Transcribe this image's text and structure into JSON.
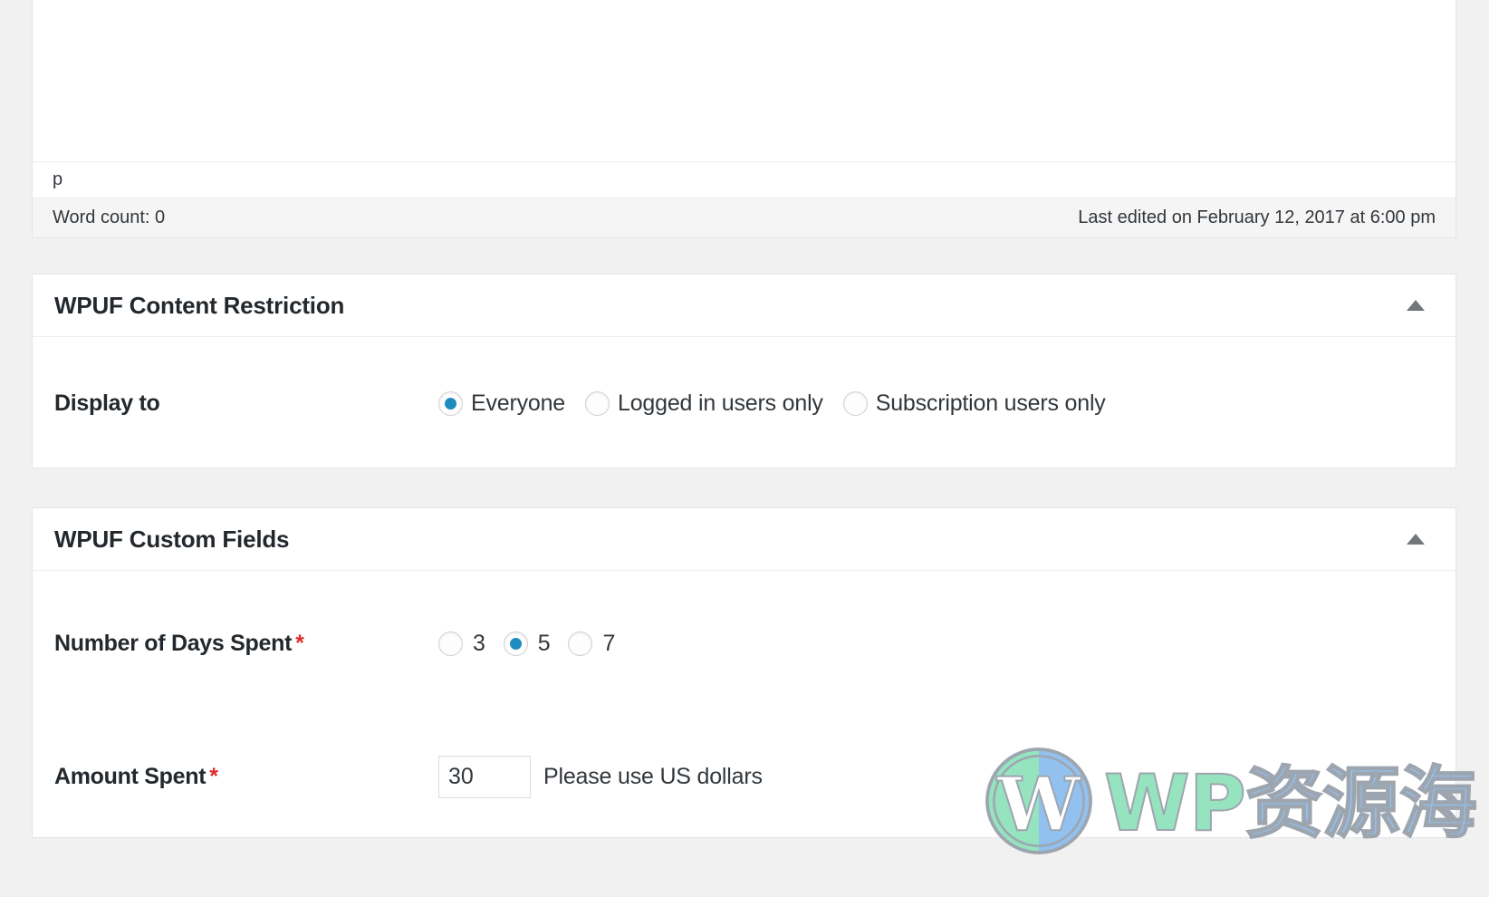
{
  "editor": {
    "path_label": "p",
    "word_count": "Word count: 0",
    "last_edited": "Last edited on February 12, 2017 at 6:00 pm"
  },
  "panels": [
    {
      "id": "content-restriction",
      "title": "WPUF Content Restriction",
      "toggle_icon": "chevron-up-icon",
      "rows": [
        {
          "label": "Display to",
          "required": false,
          "type": "radio",
          "options": [
            {
              "label": "Everyone",
              "checked": true
            },
            {
              "label": "Logged in users only",
              "checked": false
            },
            {
              "label": "Subscription users only",
              "checked": false
            }
          ]
        }
      ]
    },
    {
      "id": "custom-fields",
      "title": "WPUF Custom Fields",
      "toggle_icon": "chevron-up-icon",
      "rows": [
        {
          "label": "Number of Days Spent",
          "required": true,
          "required_mark": "*",
          "type": "radio",
          "options": [
            {
              "label": "3",
              "checked": false
            },
            {
              "label": "5",
              "checked": true
            },
            {
              "label": "7",
              "checked": false
            }
          ]
        },
        {
          "label": "Amount Spent",
          "required": true,
          "required_mark": "*",
          "type": "text",
          "value": "30",
          "help": "Please use US dollars"
        }
      ]
    }
  ],
  "watermark": {
    "logo_icon": "wordpress-logo-icon",
    "latin_text": "WP",
    "cjk_text": "资源海"
  },
  "colors": {
    "accent_radio": "#1e8cbe",
    "required_asterisk": "#e02b2b",
    "page_background": "#f1f1f1",
    "panel_background": "#ffffff",
    "panel_border": "#e5e5e5",
    "statusbar_background": "#f5f5f5",
    "watermark_green": "#93e3bd",
    "watermark_blue": "#8fc0f0"
  }
}
